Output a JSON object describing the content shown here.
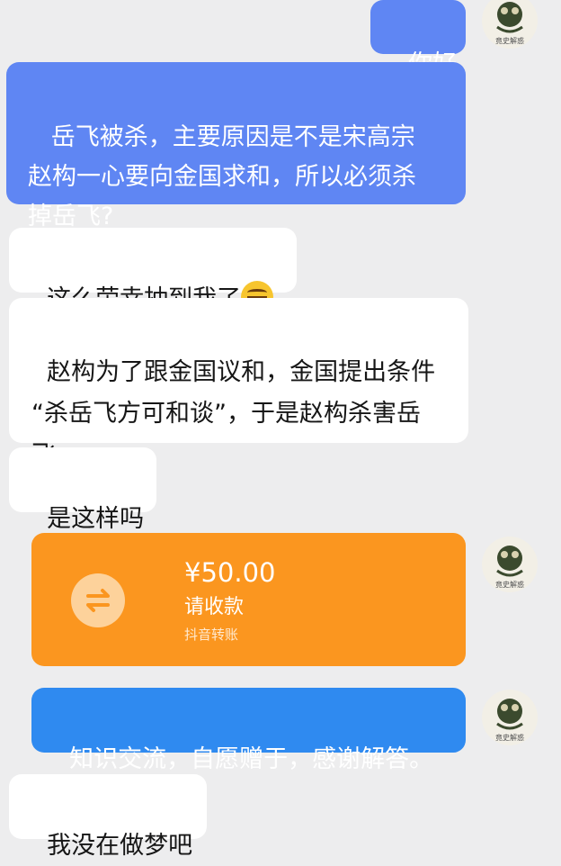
{
  "messages": [
    {
      "side": "right",
      "text": "你好"
    },
    {
      "side": "right",
      "text": " 岳飞被杀，主要原因是不是宋高宗\n赵构一心要向金国求和，所以必须杀\n掉岳飞?"
    },
    {
      "side": "left",
      "text": "这么荣幸抽到我了",
      "emoji": "grin-emoji"
    },
    {
      "side": "left",
      "text": "赵构为了跟金国议和，金国提出条件\n“杀岳飞方可和谈”，于是赵构杀害岳\n飞。"
    },
    {
      "side": "left",
      "text": "是这样吗"
    },
    {
      "side": "right",
      "text": "知识交流，自愿赠于，感谢解答。"
    },
    {
      "side": "left",
      "text": "我没在做梦吧"
    }
  ],
  "transfer": {
    "amount": "¥50.00",
    "label": "请收款",
    "source": "抖音转账",
    "icon": "swap-arrows-icon"
  },
  "avatar": {
    "icon": "frog-avatar-icon",
    "caption": "竟史解惑"
  },
  "colors": {
    "background": "#ededee",
    "blue_bubble": "#5f86f3",
    "blue_bubble_2": "#2f8af0",
    "transfer_orange": "#fb961f",
    "white_bubble": "#ffffff"
  }
}
